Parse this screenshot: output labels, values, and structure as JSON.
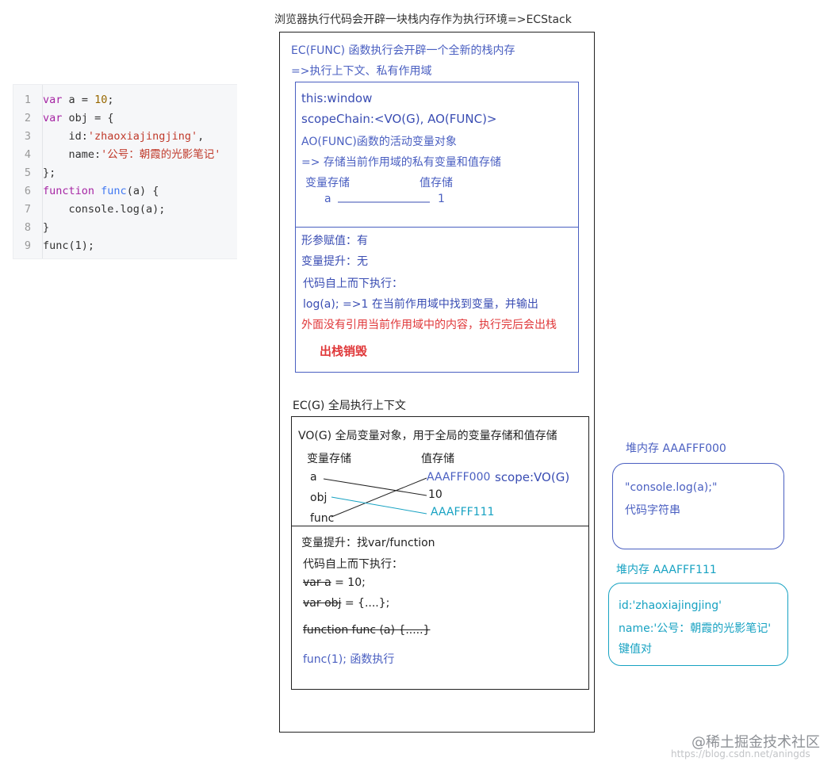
{
  "title": "浏览器执行代码会开辟一块栈内存作为执行环境=>ECStack",
  "code": {
    "lines": [
      {
        "n": "1"
      },
      {
        "n": "2"
      },
      {
        "n": "3"
      },
      {
        "n": "4"
      },
      {
        "n": "5"
      },
      {
        "n": "6"
      },
      {
        "n": "7"
      },
      {
        "n": "8"
      },
      {
        "n": "9"
      }
    ],
    "tokens": {
      "var": "var",
      "a": "a",
      "eq": "=",
      "ten": "10",
      "semi": ";",
      "obj": "obj",
      "open": "{",
      "id_key": "id:",
      "id_val": "'zhaoxiajingjing'",
      "comma": ",",
      "name_key": "name:",
      "name_val": "'公号：朝霞的光影笔记'",
      "close": "};",
      "function": "function",
      "func": "func",
      "params": "(a) {",
      "console": "console.log(a);",
      "closebrace": "}",
      "call_func": "func",
      "call_args": "(1);"
    }
  },
  "ec_func": {
    "heading1": "EC(FUNC) 函数执行会开辟一个全新的栈内存",
    "heading2": "=>执行上下文、私有作用域",
    "this": "this:window",
    "scope_chain": "scopeChain:<VO(G), AO(FUNC)>",
    "ao_title": "AO(FUNC)函数的活动变量对象",
    "ao_desc": "=> 存储当前作用域的私有变量和值存储",
    "var_header": "变量存储",
    "val_header": "值存储",
    "var_a": "a",
    "val_1": "1",
    "param_assign": "形参赋值：有",
    "hoist": "变量提升：无",
    "exec": "代码自上而下执行：",
    "log_line": "log(a); =>1 在当前作用域中找到变量，并输出",
    "note": "外面没有引用当前作用域中的内容，执行完后会出栈",
    "destroy": "出栈销毁"
  },
  "ec_g": {
    "heading": "EC(G) 全局执行上下文",
    "vo_title": "VO(G) 全局变量对象，用于全局的变量存储和值存储",
    "var_header": "变量存储",
    "val_header": "值存储",
    "vars": [
      "a",
      "obj",
      "func"
    ],
    "val_func_addr": "AAAFFF000",
    "scope": "scope:VO(G)",
    "val_10": "10",
    "val_obj_addr": "AAAFFF111",
    "hoist": "变量提升：找var/function",
    "exec": "代码自上而下执行：",
    "var_a_strike": "var a",
    "var_a_rest": " = 10;",
    "var_obj_strike": "var obj",
    "var_obj_rest": " = {....};",
    "func_decl": "function func (a) {.....}",
    "func_call": "func(1); 函数执行"
  },
  "heap_func": {
    "label": "堆内存 AAAFFF000",
    "content": "\"console.log(a);\"",
    "desc": "代码字符串"
  },
  "heap_obj": {
    "label": "堆内存 AAAFFF111",
    "id": "id:'zhaoxiajingjing'",
    "name": "name:'公号：朝霞的光影笔记'",
    "desc": "键值对"
  },
  "watermark": {
    "brand": "@稀土掘金技术社区",
    "url": "https://blog.csdn.net/aningds"
  },
  "colors": {
    "blue": "#3a4db3",
    "cyan": "#17a2c2",
    "red": "#e0383a"
  }
}
